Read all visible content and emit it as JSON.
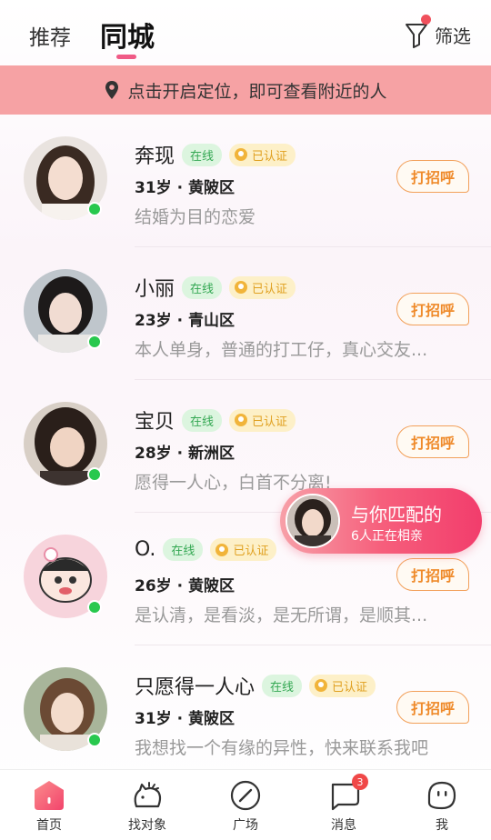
{
  "header": {
    "tab_recommend": "推荐",
    "tab_city": "同城",
    "filter_label": "筛选"
  },
  "location_banner": "点击开启定位，即可查看附近的人",
  "users": [
    {
      "name": "奔现",
      "online": "在线",
      "verified": "已认证",
      "meta": "31岁 · 黄陂区",
      "bio": "结婚为目的恋爱",
      "greet": "打招呼"
    },
    {
      "name": "小丽",
      "online": "在线",
      "verified": "已认证",
      "meta": "23岁 · 青山区",
      "bio": "本人单身，普通的打工仔，真心交友...",
      "greet": "打招呼"
    },
    {
      "name": "宝贝",
      "online": "在线",
      "verified": "已认证",
      "meta": "28岁 · 新洲区",
      "bio": "愿得一人心，白首不分离!",
      "greet": "打招呼"
    },
    {
      "name": "O.",
      "online": "在线",
      "verified": "已认证",
      "meta": "26岁 · 黄陂区",
      "bio": "是认清，是看淡，是无所谓，是顺其...",
      "greet": "打招呼"
    },
    {
      "name": "只愿得一人心",
      "online": "在线",
      "verified": "已认证",
      "meta": "31岁 · 黄陂区",
      "bio": "我想找一个有缘的异性，快来联系我吧",
      "greet": "打招呼"
    }
  ],
  "match_float": {
    "title": "与你匹配的",
    "subtitle": "6人正在相亲"
  },
  "tabbar": {
    "items": [
      {
        "label": "首页",
        "icon": "home-icon"
      },
      {
        "label": "找对象",
        "icon": "find-partner-icon"
      },
      {
        "label": "广场",
        "icon": "compass-icon"
      },
      {
        "label": "消息",
        "icon": "message-icon",
        "badge": "3"
      },
      {
        "label": "我",
        "icon": "profile-icon"
      }
    ]
  },
  "colors": {
    "accent": "#f05a86",
    "banner": "#f6a2a4",
    "greet": "#ef8a2a",
    "online": "#28c84e"
  }
}
